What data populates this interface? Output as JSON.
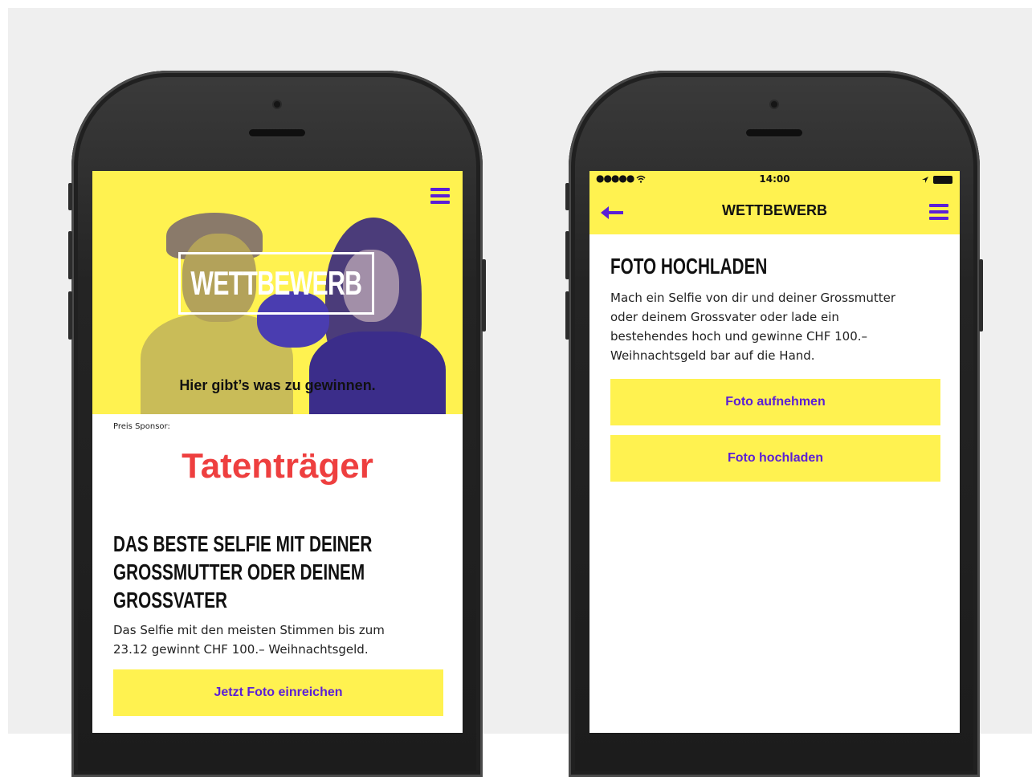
{
  "left_screen": {
    "hero": {
      "logo_text": "WETTBEWERB",
      "tagline": "Hier gibt’s was zu gewinnen."
    },
    "sponsor": {
      "label": "Preis Sponsor:",
      "logo_text": "Tatenträger"
    },
    "headline_lines": [
      "DAS BESTE SELFIE MIT DEINER",
      "GROSSMUTTER ODER DEINEM",
      "GROSSVATER"
    ],
    "body_lines": [
      "Das Selfie mit den meisten Stimmen bis zum",
      "23.12 gewinnt CHF 100.– Weihnachtsgeld."
    ],
    "cta_label": "Jetzt Foto einreichen"
  },
  "right_screen": {
    "status_time": "14:00",
    "nav_title": "WETTBEWERB",
    "section_title": "FOTO HOCHLADEN",
    "body_lines": [
      "Mach ein Selfie von dir und deiner Grossmutter",
      "oder deinem Grossvater oder lade ein",
      "bestehendes hoch und gewinne CHF 100.–",
      "Weihnachtsgeld bar auf die Hand."
    ],
    "buttons": {
      "take_photo": "Foto aufnehmen",
      "upload_photo": "Foto hochladen"
    }
  },
  "colors": {
    "accent_yellow": "#fff250",
    "accent_purple": "#5b1fd6",
    "sponsor_red": "#ee3f3f",
    "backdrop": "#efefef"
  },
  "icons": [
    "hamburger-menu-icon",
    "back-arrow-icon",
    "signal-icon",
    "wifi-icon",
    "location-icon",
    "battery-icon"
  ]
}
